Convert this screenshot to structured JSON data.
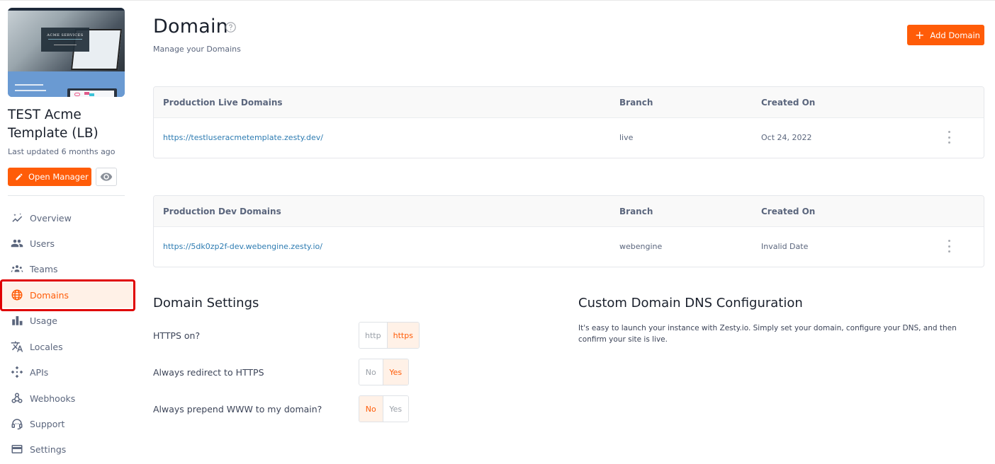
{
  "sidebar": {
    "thumbnail": {
      "heading": "ACME SERVICES"
    },
    "site_title": "TEST Acme Template (LB)",
    "last_updated": "Last updated 6 months ago",
    "open_manager_label": "Open Manager",
    "nav": [
      {
        "label": "Overview",
        "icon": "overview-icon",
        "active": false
      },
      {
        "label": "Users",
        "icon": "users-icon",
        "active": false
      },
      {
        "label": "Teams",
        "icon": "teams-icon",
        "active": false
      },
      {
        "label": "Domains",
        "icon": "globe-icon",
        "active": true
      },
      {
        "label": "Usage",
        "icon": "bar-chart-icon",
        "active": false
      },
      {
        "label": "Locales",
        "icon": "translate-icon",
        "active": false
      },
      {
        "label": "APIs",
        "icon": "api-icon",
        "active": false
      },
      {
        "label": "Webhooks",
        "icon": "webhook-icon",
        "active": false
      },
      {
        "label": "Support",
        "icon": "support-icon",
        "active": false
      },
      {
        "label": "Settings",
        "icon": "card-icon",
        "active": false
      }
    ]
  },
  "header": {
    "title": "Domain",
    "subtitle": "Manage your Domains",
    "add_domain_label": "Add Domain"
  },
  "tables": [
    {
      "columns": [
        "Production Live Domains",
        "Branch",
        "Created On"
      ],
      "rows": [
        {
          "domain": "https://testluseracmetemplate.zesty.dev/",
          "branch": "live",
          "created": "Oct 24, 2022"
        }
      ]
    },
    {
      "columns": [
        "Production Dev Domains",
        "Branch",
        "Created On"
      ],
      "rows": [
        {
          "domain": "https://5dk0zp2f-dev.webengine.zesty.io/",
          "branch": "webengine",
          "created": "Invalid Date"
        }
      ]
    }
  ],
  "domain_settings": {
    "title": "Domain Settings",
    "items": [
      {
        "label": "HTTPS on?",
        "options": [
          "http",
          "https"
        ],
        "selected": "https"
      },
      {
        "label": "Always redirect to HTTPS",
        "options": [
          "No",
          "Yes"
        ],
        "selected": "Yes"
      },
      {
        "label": "Always prepend WWW to my domain?",
        "options": [
          "No",
          "Yes"
        ],
        "selected": "No"
      }
    ]
  },
  "dns": {
    "title": "Custom Domain DNS Configuration",
    "text": "It's easy to launch your instance with Zesty.io. Simply set your domain, configure your DNS, and then confirm your site is live."
  },
  "colors": {
    "accent": "#ff5c08",
    "accent_light": "#fff1e7",
    "link": "#2e7cb2",
    "highlight_outline": "#e00000"
  }
}
